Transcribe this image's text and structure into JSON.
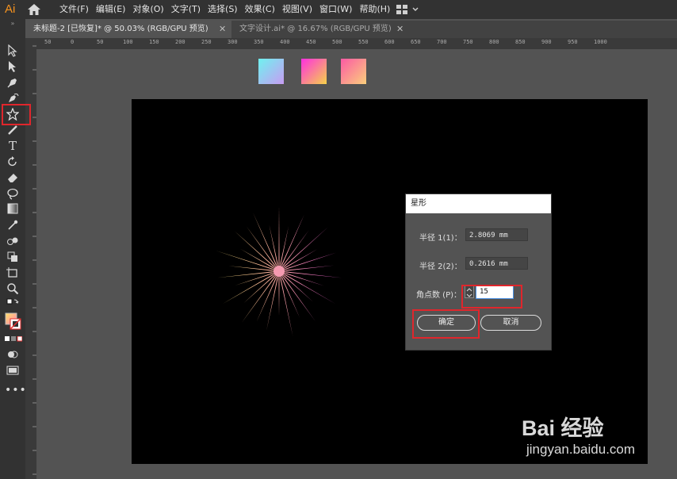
{
  "app": {
    "logo": "Ai"
  },
  "menu": [
    "文件(F)",
    "编辑(E)",
    "对象(O)",
    "文字(T)",
    "选择(S)",
    "效果(C)",
    "视图(V)",
    "窗口(W)",
    "帮助(H)"
  ],
  "tabs": [
    {
      "label": "未标题-2 [已恢复]* @ 50.03% (RGB/GPU 预览)",
      "active": true
    },
    {
      "label": "文字设计.ai* @ 16.67% (RGB/GPU 预览)",
      "active": false
    }
  ],
  "ruler_h": [
    "50",
    "0",
    "50",
    "100",
    "150",
    "200",
    "250",
    "300",
    "350",
    "400",
    "450",
    "500",
    "550",
    "600",
    "650",
    "700",
    "750",
    "800",
    "850",
    "900",
    "950",
    "1000"
  ],
  "swatches": [
    {
      "from": "#6ff2f0",
      "to": "#c79cf2"
    },
    {
      "from": "#ff2fe0",
      "to": "#f6d24a"
    },
    {
      "from": "#fb5aa4",
      "to": "#fbcf7c"
    }
  ],
  "dialog": {
    "title": "星形",
    "radius1_label": "半径 1(1)：",
    "radius1_value": "2.8069 mm",
    "radius2_label": "半径 2(2)：",
    "radius2_value": "0.2616 mm",
    "points_label": "角点数 (P)：",
    "points_value": "15",
    "ok": "确定",
    "cancel": "取消"
  },
  "starburst": {
    "points": 15
  },
  "watermark": {
    "line1": "Bai 经验",
    "line2": "jingyan.baidu.com"
  }
}
